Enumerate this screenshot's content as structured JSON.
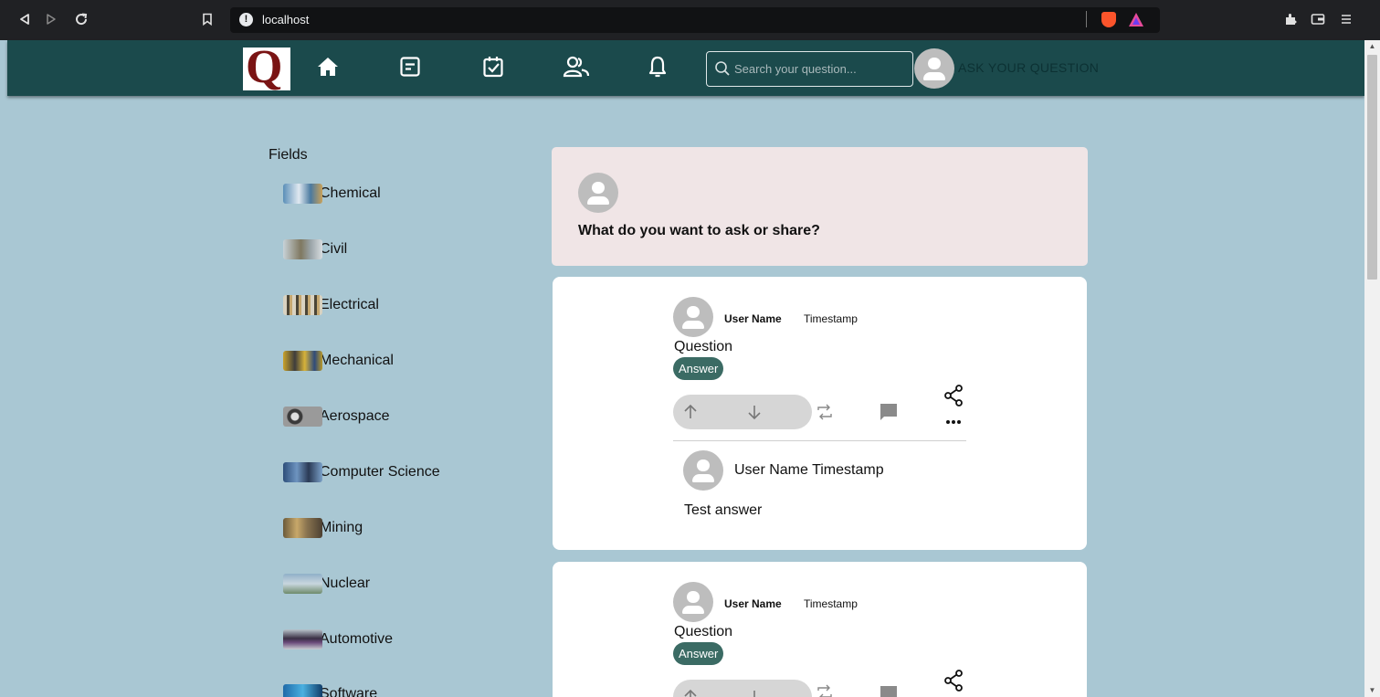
{
  "browser": {
    "url": "localhost",
    "icons": [
      "back-icon",
      "forward-icon",
      "reload-icon",
      "bookmark-icon",
      "site-info-icon",
      "brave-shields-icon",
      "brave-rewards-icon",
      "extensions-icon",
      "wallet-icon",
      "menu-icon"
    ]
  },
  "nav": {
    "logo_letter": "Q",
    "icons": [
      "home-icon",
      "following-icon",
      "answer-icon",
      "spaces-icon",
      "notifications-icon"
    ],
    "search_placeholder": "Search your question...",
    "ask_button": "ASK YOUR QUESTION",
    "colors": {
      "nav_bg": "#1b4a4c",
      "page_bg": "#a9c7d3",
      "logo": "#7a1414"
    }
  },
  "sidebar": {
    "title": "Fields",
    "items": [
      {
        "label": "Chemical"
      },
      {
        "label": "Civil"
      },
      {
        "label": "Electrical"
      },
      {
        "label": "Mechanical"
      },
      {
        "label": "Aerospace"
      },
      {
        "label": "Computer Science"
      },
      {
        "label": "Mining"
      },
      {
        "label": "Nuclear"
      },
      {
        "label": "Automotive"
      },
      {
        "label": "Software"
      }
    ]
  },
  "ask_box": {
    "prompt": "What do you want to ask or share?",
    "colors": {
      "bg": "#f0e5e6"
    }
  },
  "posts": [
    {
      "user_name": "User Name",
      "timestamp": "Timestamp",
      "question": "Question",
      "answer_button": "Answer",
      "answers": [
        {
          "header": "User Name Timestamp",
          "text": "Test answer"
        }
      ]
    },
    {
      "user_name": "User Name",
      "timestamp": "Timestamp",
      "question": "Question",
      "answer_button": "Answer",
      "answers": []
    }
  ],
  "colors": {
    "answer_button": "#3b6b64"
  }
}
